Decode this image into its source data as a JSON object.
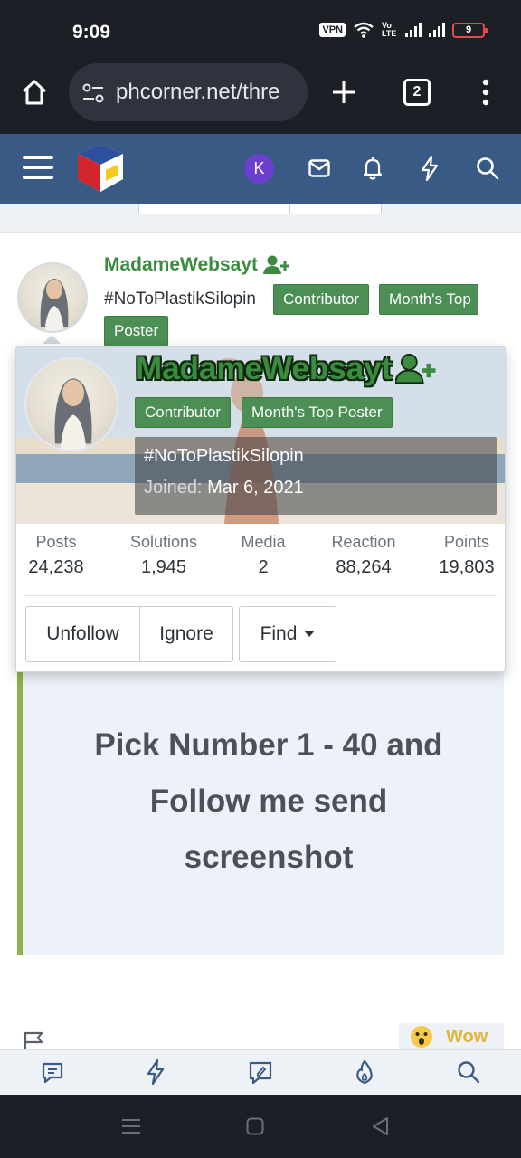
{
  "status_bar": {
    "time": "9:09",
    "vpn_label": "VPN",
    "volte_label": "Vo LTE",
    "battery_level": "9"
  },
  "browser": {
    "url": "phcorner.net/thre",
    "tab_count": "2"
  },
  "post": {
    "author": "MadameWebsayt",
    "user_title": "#NoToPlastikSilopin",
    "badges": [
      "Contributor",
      "Month's Top Poster"
    ],
    "badge_line1": "Month's Top",
    "badge_line2": "Poster",
    "message": [
      "Pick Number 1 - 40 and",
      "Follow me send",
      "screenshot"
    ],
    "reaction_label": "Wow"
  },
  "member_card": {
    "name": "MadameWebsayt",
    "badges": [
      "Contributor",
      "Month's Top Poster"
    ],
    "user_title": "#NoToPlastikSilopin",
    "joined_label": "Joined:",
    "joined_value": "Mar 6, 2021",
    "stats": [
      {
        "label": "Posts",
        "value": "24,238"
      },
      {
        "label": "Solutions",
        "value": "1,945"
      },
      {
        "label": "Media",
        "value": "2"
      },
      {
        "label": "Reaction",
        "value": "88,264"
      },
      {
        "label": "Points",
        "value": "19,803"
      }
    ],
    "buttons": {
      "unfollow": "Unfollow",
      "ignore": "Ignore",
      "find": "Find"
    }
  },
  "header": {
    "avatar_letter": "K"
  },
  "colors": {
    "header_bg": "#3a5a86",
    "username_green": "#3d8b40",
    "badge_green": "#4b8f55",
    "quote_bar": "#8db34a",
    "avatar_purple": "#6c3fd1"
  }
}
